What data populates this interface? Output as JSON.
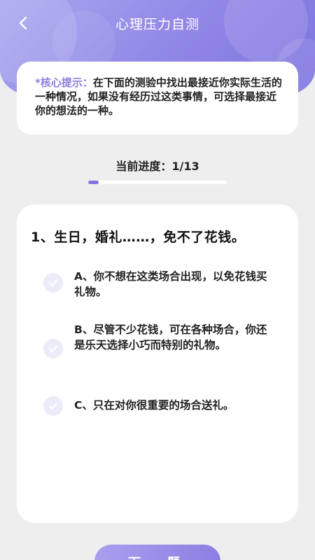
{
  "header": {
    "title": "心理压力自测"
  },
  "tip": {
    "label": "*核心提示：",
    "text": "在下面的测验中找出最接近你实际生活的一种情况，如果没有经历过这类事情，可选择最接近你的想法的一种。"
  },
  "progress": {
    "label": "当前进度：1/13",
    "current": 1,
    "total": 13
  },
  "question": {
    "text": "1、生日，婚礼……，免不了花钱。",
    "options": [
      {
        "label": "A、你不想在这类场合出现，以免花钱买礼物。"
      },
      {
        "label": "B、尽管不少花钱，可在各种场合，你还是乐天选择小巧而特别的礼物。"
      },
      {
        "label": "C、只在对你很重要的场合送礼。"
      }
    ]
  },
  "footer": {
    "next_label": "下一题"
  },
  "colors": {
    "accent": "#7f76de",
    "header_start": "#a9a7ef",
    "header_end": "#7d73df",
    "option_icon_bg": "#ecebf9"
  }
}
